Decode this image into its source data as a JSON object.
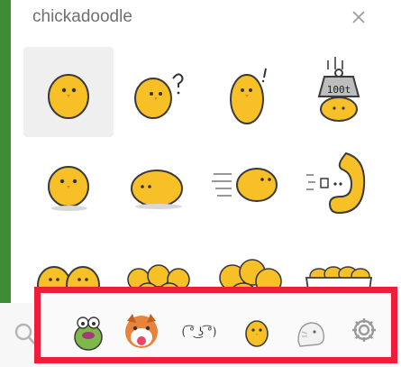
{
  "panel": {
    "title": "chickadoodle",
    "close_icon": "close-icon"
  },
  "stickers": [
    {
      "name": "chick-standing",
      "selected": true
    },
    {
      "name": "chick-question"
    },
    {
      "name": "chick-surprised"
    },
    {
      "name": "chick-under-weight"
    },
    {
      "name": "chick-front"
    },
    {
      "name": "chick-lying"
    },
    {
      "name": "chick-running"
    },
    {
      "name": "chick-curled"
    },
    {
      "name": "chick-pair"
    },
    {
      "name": "chick-crowd"
    },
    {
      "name": "chick-group"
    },
    {
      "name": "chick-box"
    }
  ],
  "weight_text": "100t",
  "tray_face_text": "( ͡° ͜ʖ ͡°)",
  "tray": [
    {
      "name": "search-icon"
    },
    {
      "name": "frog-sticker-pack"
    },
    {
      "name": "dog-sticker-pack"
    },
    {
      "name": "face-sticker-pack"
    },
    {
      "name": "chick-sticker-pack"
    },
    {
      "name": "cat-sticker-pack"
    },
    {
      "name": "gear-icon"
    }
  ],
  "colors": {
    "chick": "#f6c026",
    "outline": "#3a3a3a",
    "highlight": "#ee1d3a",
    "selected_bg": "#efefef"
  }
}
